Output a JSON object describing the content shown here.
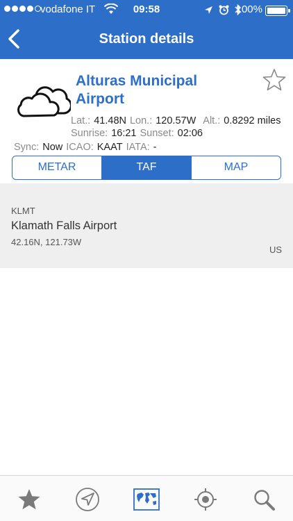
{
  "status_bar": {
    "carrier": "vodafone IT",
    "time": "09:58",
    "battery": "100%",
    "battery_level": 1.0
  },
  "nav": {
    "title": "Station details",
    "back_icon": "chevron-left-icon"
  },
  "station": {
    "name": "Alturas Municipal Airport",
    "weather_icon": "cloud-icon",
    "favorite_icon": "star-outline-icon",
    "lat_label": "Lat.:",
    "lat_value": "41.48N",
    "lon_label": "Lon.:",
    "lon_value": "120.57W",
    "alt_label": "Alt.:",
    "alt_value": "0.8292 miles",
    "sunrise_label": "Sunrise:",
    "sunrise_value": "16:21",
    "sunset_label": "Sunset:",
    "sunset_value": "02:06",
    "sync_label": "Sync:",
    "sync_value": "Now",
    "icao_label": "ICAO:",
    "icao_value": "KAAT",
    "iata_label": "IATA:",
    "iata_value": "-"
  },
  "segments": {
    "items": [
      "METAR",
      "TAF",
      "MAP"
    ],
    "selected": "TAF"
  },
  "list": {
    "items": [
      {
        "code": "KLMT",
        "name": "Klamath Falls Airport",
        "coords": "42.16N, 121.73W",
        "country": "US"
      }
    ]
  },
  "tab_bar": {
    "items": [
      "star-icon",
      "navigation-arrow-icon",
      "world-map-icon",
      "locate-icon",
      "search-icon"
    ],
    "active": "world-map-icon"
  },
  "colors": {
    "accent": "#2d6ec8",
    "list_background": "#efefef"
  }
}
